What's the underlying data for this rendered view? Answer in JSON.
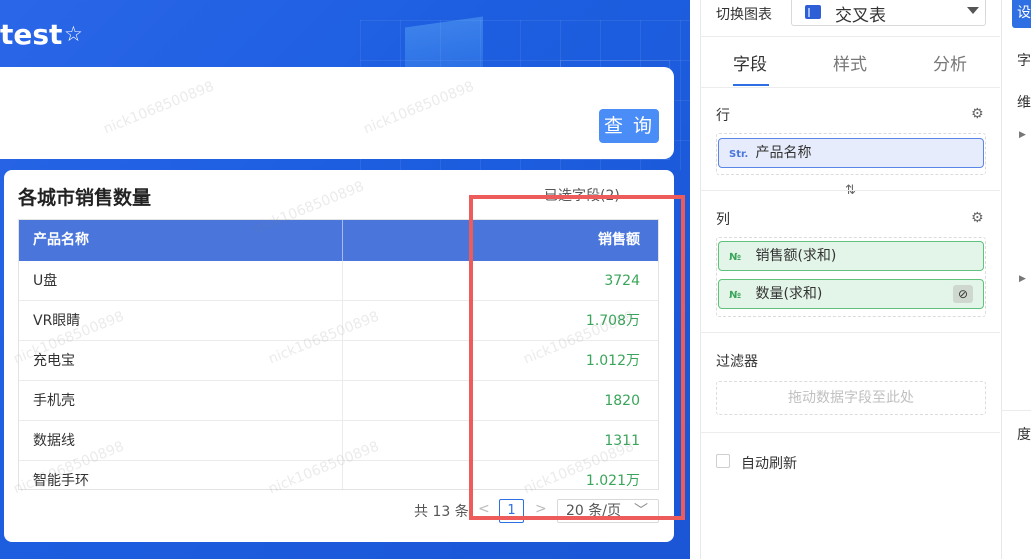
{
  "dashboard": {
    "title": "test",
    "query_button": "查 询",
    "watermark": "nick1068500898"
  },
  "table": {
    "title": "各城市销售数量",
    "selected_fields": "已选字段(2)",
    "columns": [
      "产品名称",
      "销售额"
    ],
    "rows": [
      {
        "name": "U盘",
        "value": "3724"
      },
      {
        "name": "VR眼睛",
        "value": "1.708万"
      },
      {
        "name": "充电宝",
        "value": "1.012万"
      },
      {
        "name": "手机壳",
        "value": "1820"
      },
      {
        "name": "数据线",
        "value": "1311"
      },
      {
        "name": "智能手环",
        "value": "1.021万"
      }
    ],
    "value_color": "#3aa55a",
    "header_color": "#4a76dc"
  },
  "pagination": {
    "total": "共 13 条",
    "prev": "<",
    "page": "1",
    "next": ">",
    "page_size": "20 条/页"
  },
  "panel": {
    "switch_label": "切换图表",
    "chart_type": "交叉表",
    "tabs": [
      "字段",
      "样式",
      "分析"
    ],
    "active_tab": "字段",
    "rows_label": "行",
    "row_fields": [
      {
        "type": "Str.",
        "label": "产品名称"
      }
    ],
    "cols_label": "列",
    "col_fields": [
      {
        "type": "№",
        "label": "销售额(求和)"
      },
      {
        "type": "№",
        "label": "数量(求和)"
      }
    ],
    "filter_label": "过滤器",
    "filter_placeholder": "拖动数据字段至此处",
    "auto_refresh_label": "自动刷新",
    "auto_refresh_checked": false
  },
  "right_column": {
    "button": "设",
    "items": [
      "字",
      "维",
      "度"
    ]
  },
  "colors": {
    "accent": "#2f6fe4",
    "highlight": "#ee5b5b",
    "canvas_blue": "#1d5ee0"
  }
}
